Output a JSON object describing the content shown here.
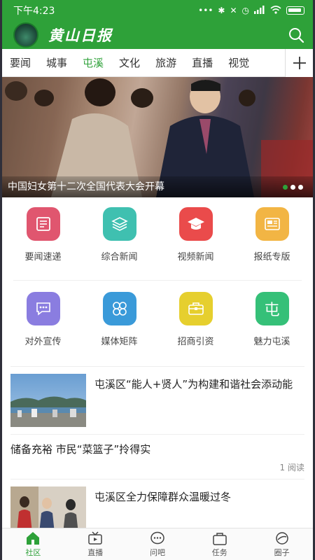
{
  "status_bar": {
    "time": "下午4:23",
    "dots": "•••"
  },
  "header": {
    "logo_text": "黄山日报"
  },
  "tabs": [
    {
      "label": "要闻",
      "active": false
    },
    {
      "label": "城事",
      "active": false
    },
    {
      "label": "屯溪",
      "active": true
    },
    {
      "label": "文化",
      "active": false
    },
    {
      "label": "旅游",
      "active": false
    },
    {
      "label": "直播",
      "active": false
    },
    {
      "label": "视觉",
      "active": false
    }
  ],
  "banner": {
    "caption": "中国妇女第十二次全国代表大会开幕"
  },
  "grid": [
    {
      "label": "要闻速递",
      "color": "#e0566f",
      "icon": "newspaper-icon"
    },
    {
      "label": "综合新闻",
      "color": "#3fc0b0",
      "icon": "layers-icon"
    },
    {
      "label": "视频新闻",
      "color": "#ea4b4b",
      "icon": "graduation-cap-icon"
    },
    {
      "label": "报纸专版",
      "color": "#f2b544",
      "icon": "newspaper-page-icon"
    },
    {
      "label": "对外宣传",
      "color": "#8a7de0",
      "icon": "chat-bubble-icon"
    },
    {
      "label": "媒体矩阵",
      "color": "#3a9ad9",
      "icon": "four-circles-icon"
    },
    {
      "label": "招商引资",
      "color": "#e6cf2e",
      "icon": "briefcase-icon"
    },
    {
      "label": "魅力屯溪",
      "color": "#35c078",
      "icon": "tunxi-character-icon",
      "glyph": "屯"
    }
  ],
  "news": [
    {
      "title": "屯溪区“能人+贤人”为构建和谐社会添动能",
      "type": "thumb"
    },
    {
      "title": "储备充裕 市民“菜篮子”拎得实",
      "type": "text",
      "meta": "1 阅读"
    },
    {
      "title": "屯溪区全力保障群众温暖过冬",
      "type": "thumb"
    }
  ],
  "bottom_nav": [
    {
      "label": "社区",
      "icon": "home-icon",
      "active": true
    },
    {
      "label": "直播",
      "icon": "tv-icon",
      "active": false
    },
    {
      "label": "问吧",
      "icon": "chat-dots-icon",
      "active": false
    },
    {
      "label": "任务",
      "icon": "task-bag-icon",
      "active": false
    },
    {
      "label": "圈子",
      "icon": "circle-icon",
      "active": false
    }
  ],
  "colors": {
    "brand": "#2ea139"
  }
}
